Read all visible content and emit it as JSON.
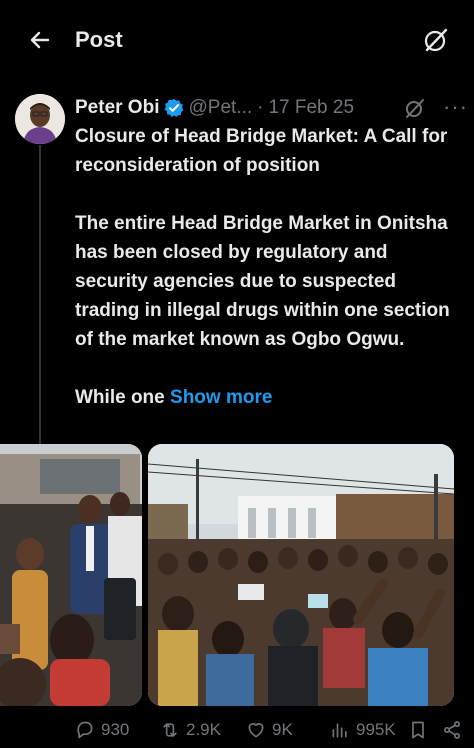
{
  "header": {
    "title": "Post"
  },
  "post": {
    "author_name": "Peter Obi",
    "handle": "@Pet...",
    "separator": "·",
    "date": "17 Feb 25",
    "more": "···",
    "paragraph1": "Closure of Head Bridge Market: A Call for reconsideration of position",
    "paragraph2": "The entire Head Bridge Market in Onitsha has been closed by regulatory and security agencies due to suspected trading in illegal drugs within one section of the market known as Ogbo Ogwu.",
    "paragraph3_prefix": "While one",
    "show_more": "Show more"
  },
  "actions": {
    "replies": "930",
    "reposts": "2.9K",
    "likes": "9K",
    "views": "995K"
  },
  "colors": {
    "background": "#000000",
    "text": "#e7e9ea",
    "secondary": "#71767b",
    "accent": "#1d9bf0",
    "verified": "#1d9bf0"
  },
  "icons": [
    "back-arrow-icon",
    "grok-icon",
    "verified-badge-icon",
    "more-icon",
    "reply-icon",
    "repost-icon",
    "like-icon",
    "views-icon",
    "bookmark-icon",
    "share-icon"
  ]
}
